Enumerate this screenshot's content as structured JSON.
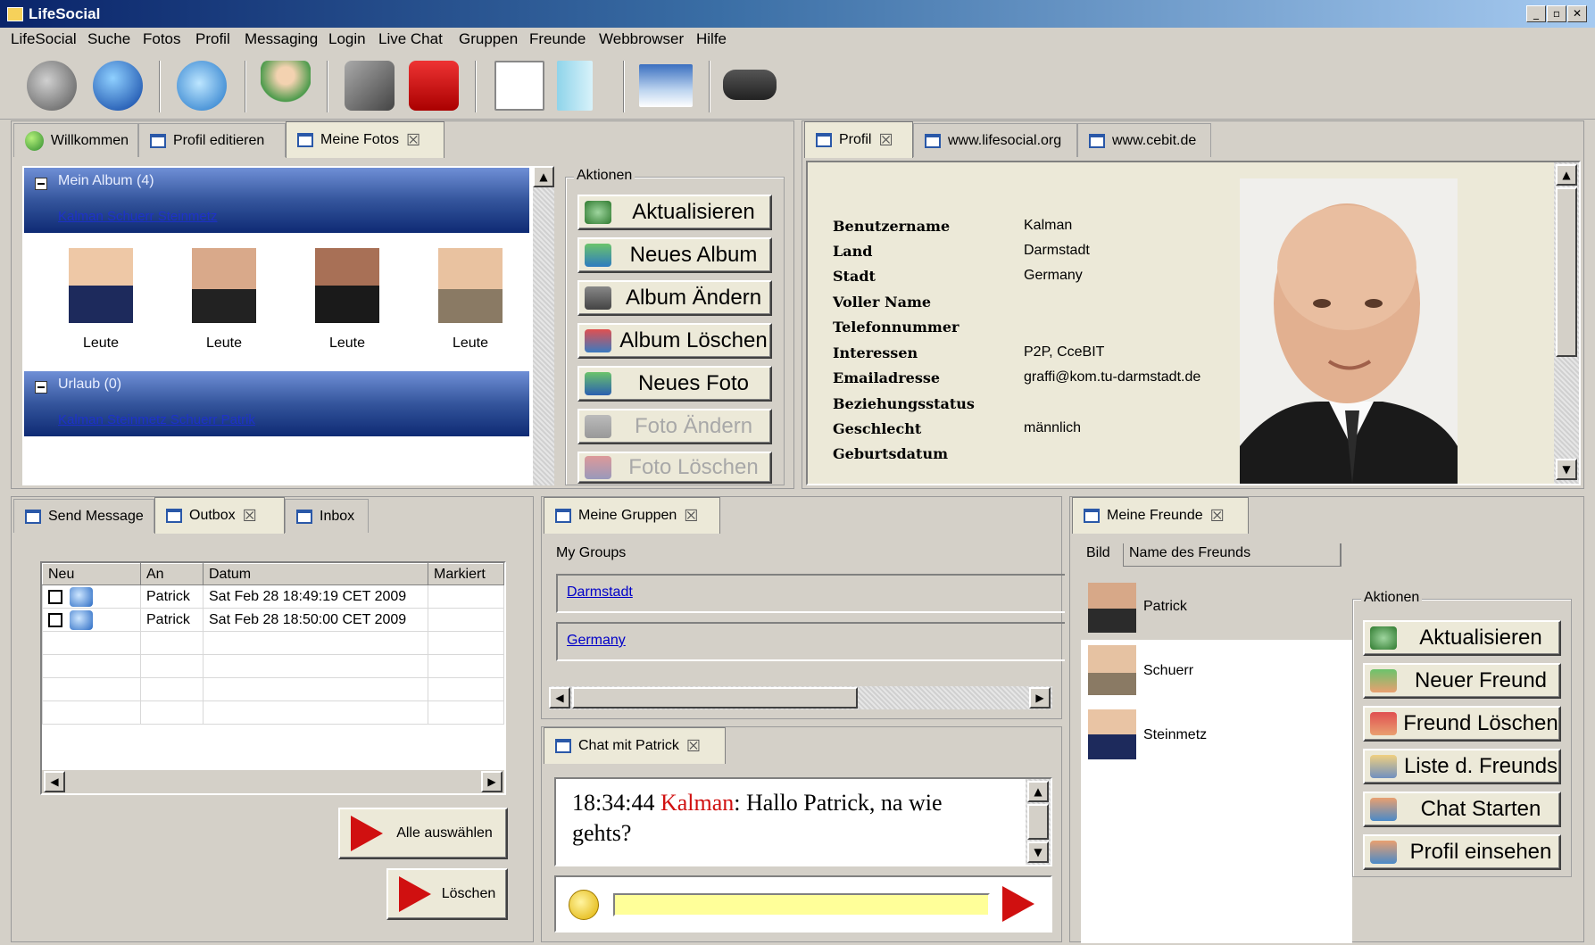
{
  "window": {
    "title": "LifeSocial",
    "min": "_",
    "max": "▫",
    "close": "✕"
  },
  "menu": [
    "LifeSocial",
    "Suche",
    "Fotos",
    "Profil",
    "Messaging",
    "Login",
    "Live Chat",
    "Gruppen",
    "Freunde",
    "Webbrowser",
    "Hilfe"
  ],
  "top_left_tabs": [
    "Willkommen",
    "Profil editieren",
    "Meine Fotos"
  ],
  "top_right_tabs": [
    "Profil",
    "www.lifesocial.org",
    "www.cebit.de"
  ],
  "albums": [
    {
      "title": "Mein Album (4)",
      "members": "Kalman Schuerr Steinmetz"
    },
    {
      "title": "Urlaub (0)",
      "members": "Kalman Steinmetz Schuerr Patrik"
    }
  ],
  "photos": [
    "Leute",
    "Leute",
    "Leute",
    "Leute"
  ],
  "photo_actions": {
    "legend": "Aktionen",
    "buttons": [
      "Aktualisieren",
      "Neues Album",
      "Album Ändern",
      "Album Löschen",
      "Neues Foto",
      "Foto Ändern",
      "Foto Löschen"
    ]
  },
  "profile": {
    "rows": [
      {
        "label": "Benutzername",
        "value": "Kalman"
      },
      {
        "label": "Land",
        "value": "Darmstadt"
      },
      {
        "label": "Stadt",
        "value": "Germany"
      },
      {
        "label": "Voller Name",
        "value": ""
      },
      {
        "label": "Telefonnummer",
        "value": ""
      },
      {
        "label": "Interessen",
        "value": "P2P, CceBIT"
      },
      {
        "label": "Emailadresse",
        "value": "graffi@kom.tu-darmstadt.de"
      },
      {
        "label": "Beziehungsstatus",
        "value": ""
      },
      {
        "label": "Geschlecht",
        "value": "männlich"
      },
      {
        "label": "Geburtsdatum",
        "value": ""
      }
    ]
  },
  "message_tabs": [
    "Send Message",
    "Outbox",
    "Inbox"
  ],
  "outbox": {
    "columns": [
      "Neu",
      "An",
      "Datum",
      "Markiert"
    ],
    "rows": [
      {
        "to": "Patrick",
        "date": "Sat Feb 28 18:49:19 CET 2009"
      },
      {
        "to": "Patrick",
        "date": "Sat Feb 28 18:50:00 CET 2009"
      }
    ],
    "select_all": "Alle auswählen",
    "delete": "Löschen"
  },
  "groups": {
    "tab": "Meine Gruppen",
    "header": "My Groups",
    "items": [
      "Darmstadt",
      "Germany"
    ]
  },
  "chat": {
    "tab": "Chat mit Patrick",
    "time": "18:34:44",
    "sender": "Kalman",
    "message": ": Hallo Patrick, na wie gehts?",
    "input": ""
  },
  "friends": {
    "tab": "Meine Freunde",
    "columns": [
      "Bild",
      "Name des Freunds"
    ],
    "items": [
      "Patrick",
      "Schuerr",
      "Steinmetz"
    ],
    "legend": "Aktionen",
    "buttons": [
      "Aktualisieren",
      "Neuer Freund",
      "Freund Löschen",
      "Liste d. Freunds",
      "Chat Starten",
      "Profil einsehen"
    ]
  },
  "colors": {
    "album_header": "#34559c",
    "chat_sender": "#d01010",
    "input_bg": "#ffff99"
  }
}
